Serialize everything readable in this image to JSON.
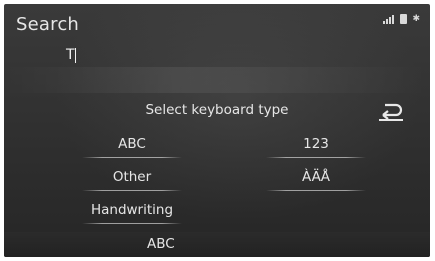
{
  "header": {
    "title": "Search",
    "bluetooth_glyph": "✱"
  },
  "search": {
    "value": "T"
  },
  "dialog": {
    "title": "Select keyboard type",
    "options": [
      {
        "label": "ABC"
      },
      {
        "label": "123"
      },
      {
        "label": "Other"
      },
      {
        "label": "ÀÄÅ"
      },
      {
        "label": "Handwriting"
      }
    ],
    "back_icon": "return-icon"
  },
  "footer": {
    "current_type": "ABC"
  }
}
